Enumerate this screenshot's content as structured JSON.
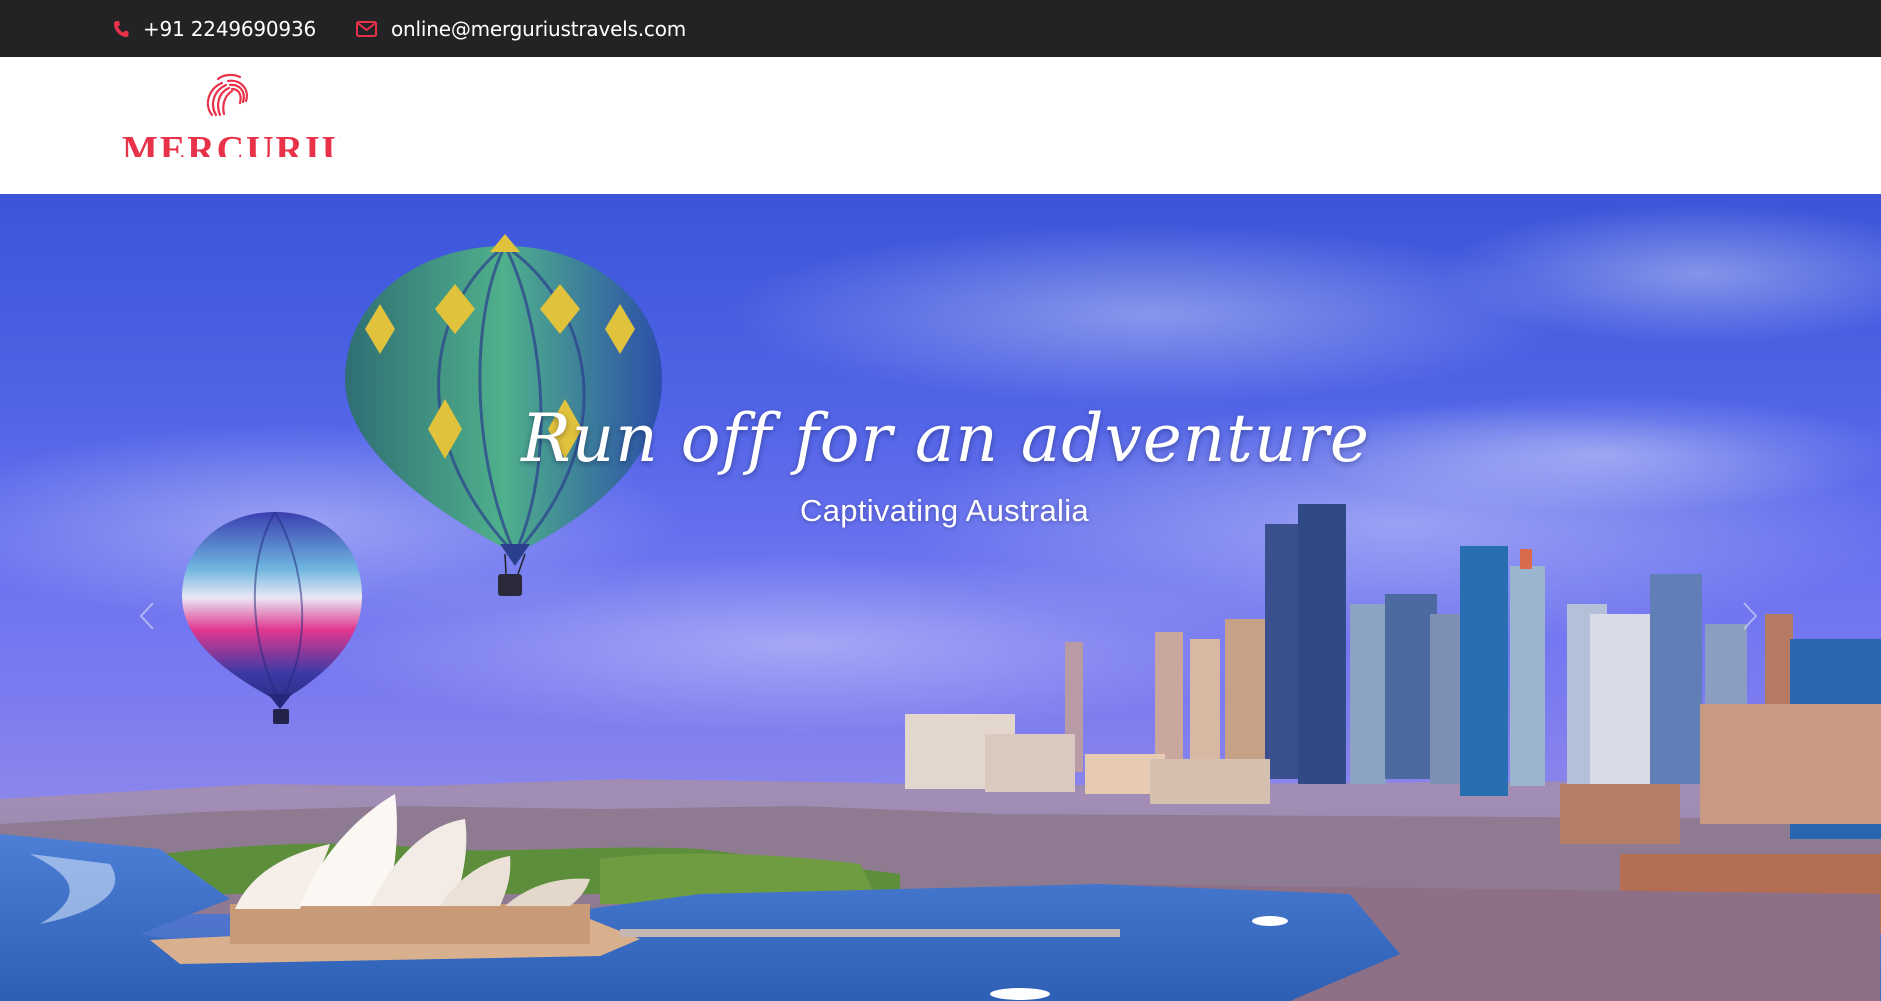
{
  "topbar": {
    "phone": {
      "icon": "phone-icon",
      "text": "+91 2249690936"
    },
    "email": {
      "icon": "envelope-icon",
      "text": "online@merguriustravels.com"
    }
  },
  "header": {
    "logo_text": "MERCURIUS"
  },
  "hero": {
    "title": "Run off for an adventure",
    "subtitle": "Captivating Australia",
    "prev_icon": "chevron-left-icon",
    "next_icon": "chevron-right-icon"
  },
  "colors": {
    "topbar_bg": "#232326",
    "accent": "#e8324a",
    "sky": "#4f63e6"
  }
}
